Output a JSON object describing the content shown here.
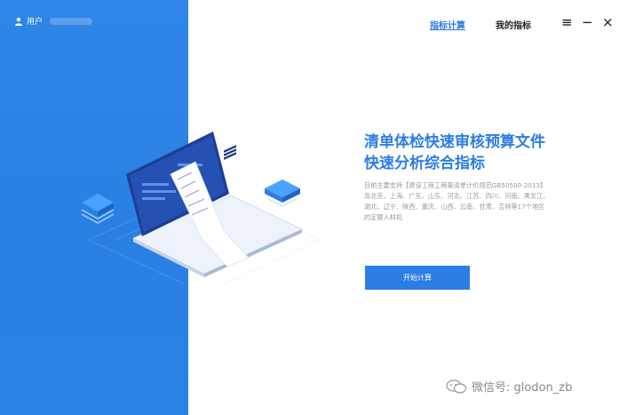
{
  "header": {
    "user_label": "用户",
    "nav": [
      "指标计算",
      "我的指标"
    ],
    "controls": [
      "≡",
      "−",
      "×"
    ]
  },
  "main": {
    "headline_line1": "清单体检快速审核预算文件",
    "headline_line2": "快速分析综合指标",
    "description": "目前主要支持【建设工程工程量清单计价规范GB50500-2013】及北京、上海、广东、山东、河北、江苏、四川、河南、黑龙江、湖北、辽宁、陕西、重庆、山西、云南、甘肃、吉林等17个地区的定额人材机",
    "start_button": "开始计算"
  },
  "watermark": {
    "text": "微信号: glodon_zb"
  },
  "colors": {
    "brand_blue": "#2b7de4",
    "panel_blue": "#2f86e8"
  }
}
